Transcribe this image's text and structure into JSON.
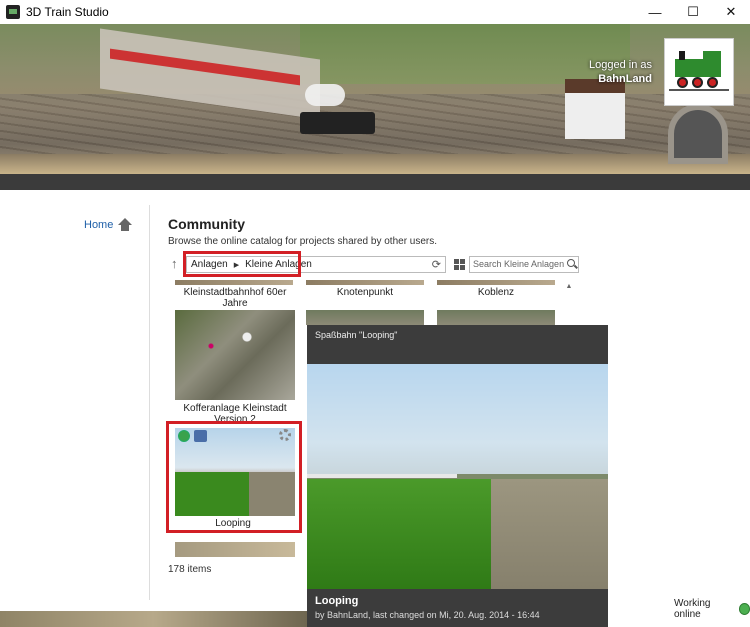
{
  "window": {
    "title": "3D Train Studio",
    "min": "—",
    "max": "☐",
    "close": "✕"
  },
  "header": {
    "login_label": "Logged in as",
    "username": "BahnLand"
  },
  "sidebar": {
    "home_label": "Home"
  },
  "page": {
    "title": "Community",
    "description": "Browse the online catalog for projects shared by other users."
  },
  "breadcrumb": {
    "items": [
      "Anlagen",
      "Kleine Anlagen"
    ],
    "separator": "▶"
  },
  "search": {
    "placeholder": "Search Kleine Anlagen"
  },
  "catalog": {
    "tiles": [
      "Kleinstadtbahnhof 60er Jahre",
      "Knotenpunkt",
      "Koblenz",
      "Kofferanlage Kleinstadt Version 2",
      "Looping"
    ],
    "items_count": "178 items"
  },
  "preview": {
    "title": "Spaßbahn \"Looping\"",
    "name": "Looping",
    "meta": "by BahnLand, last changed on Mi, 20. Aug. 2014 - 16:44"
  },
  "status": {
    "text": "Working online"
  },
  "colors": {
    "highlight": "#d21f25",
    "link": "#1e5fa8",
    "popup_bg": "#3c3c3c"
  }
}
